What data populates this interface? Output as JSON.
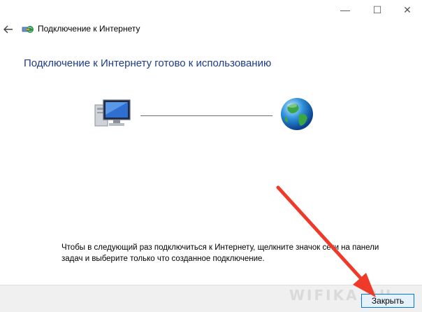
{
  "window": {
    "minimize_glyph": "—",
    "maximize_glyph": "☐",
    "close_glyph": "✕"
  },
  "nav": {
    "title": "Подключение к Интернету"
  },
  "main": {
    "heading": "Подключение к Интернету готово к использованию",
    "hint": "Чтобы в следующий раз подключиться к Интернету, щелкните значок сети на панели задач и выберите только что созданное подключение."
  },
  "footer": {
    "close_label": "Закрыть",
    "watermark": "WIFIKA.RU"
  },
  "colors": {
    "heading": "#1c3b8c",
    "arrow": "#ef3a2a",
    "button_border": "#0078d7",
    "footer_bg": "#f0f0f0"
  },
  "icons": [
    "back-arrow-icon",
    "network-connection-icon",
    "computer-icon",
    "globe-icon"
  ]
}
